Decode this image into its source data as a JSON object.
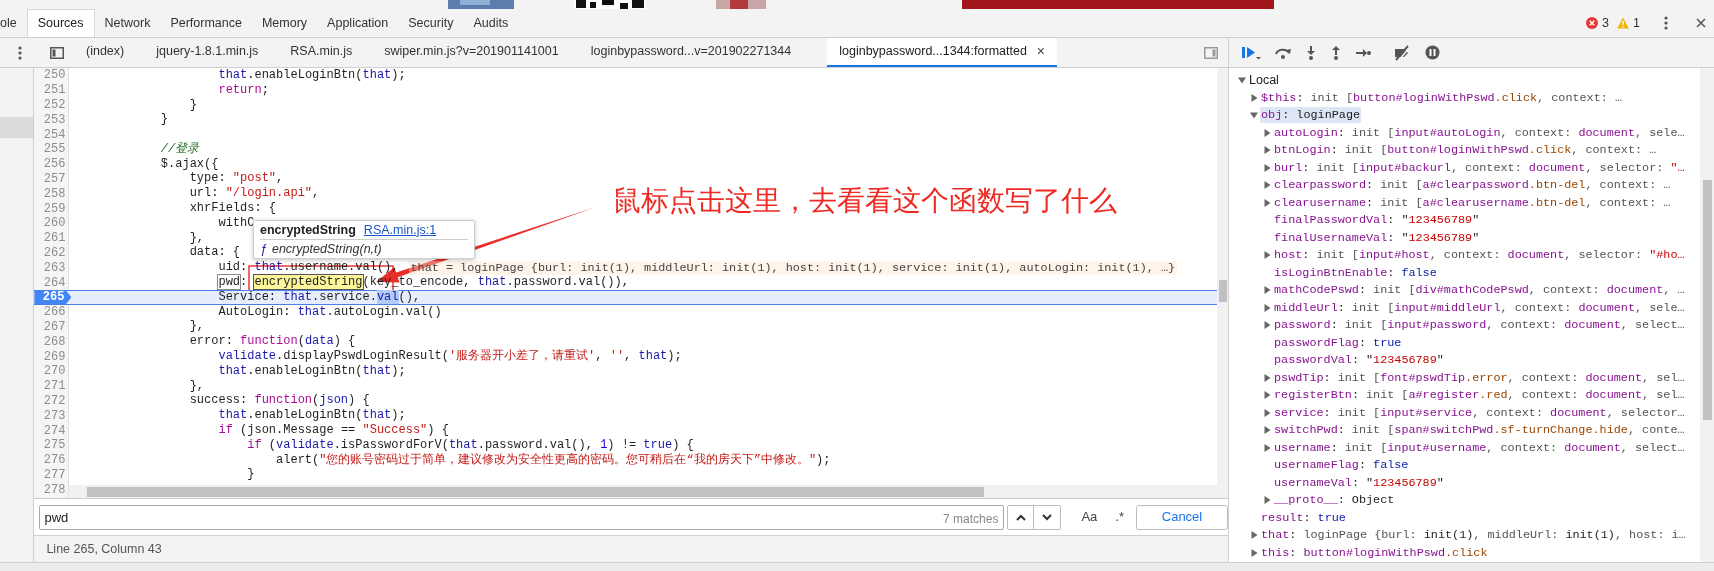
{
  "top_tabs": [
    {
      "label": "ole",
      "selected": false
    },
    {
      "label": "Sources",
      "selected": true
    },
    {
      "label": "Network",
      "selected": false
    },
    {
      "label": "Performance",
      "selected": false
    },
    {
      "label": "Memory",
      "selected": false
    },
    {
      "label": "Application",
      "selected": false
    },
    {
      "label": "Security",
      "selected": false
    },
    {
      "label": "Audits",
      "selected": false
    }
  ],
  "issue_counts": {
    "errors": "3",
    "warnings": "1"
  },
  "file_tabs": [
    {
      "label": "(index)",
      "selected": false
    },
    {
      "label": "jquery-1.8.1.min.js",
      "selected": false
    },
    {
      "label": "RSA.min.js",
      "selected": false
    },
    {
      "label": "swiper.min.js?v=201901141001",
      "selected": false
    },
    {
      "label": "loginbypassword...v=201902271344",
      "selected": false
    },
    {
      "label": "loginbypassword...1344:formatted",
      "selected": true,
      "close": "×"
    }
  ],
  "editor": {
    "lines": [
      {
        "number": "250",
        "paused": false,
        "tokens": [
          {
            "kind": "variable",
            "text": "                    that"
          },
          {
            "kind": "plain",
            "text": ".enableLoginBtn("
          },
          {
            "kind": "variable",
            "text": "that"
          },
          {
            "kind": "plain",
            "text": ");"
          }
        ]
      },
      {
        "number": "251",
        "paused": false,
        "tokens": [
          {
            "kind": "keyword",
            "text": "                    return"
          },
          {
            "kind": "plain",
            "text": ";"
          }
        ]
      },
      {
        "number": "252",
        "paused": false,
        "tokens": [
          {
            "kind": "plain",
            "text": "                }"
          }
        ]
      },
      {
        "number": "253",
        "paused": false,
        "tokens": [
          {
            "kind": "plain",
            "text": "            }"
          }
        ]
      },
      {
        "number": "254",
        "paused": false
      },
      {
        "number": "255",
        "paused": false,
        "tokens": [
          {
            "kind": "comment",
            "text": "            //登录"
          }
        ]
      },
      {
        "number": "256",
        "paused": false,
        "tokens": [
          {
            "kind": "plain",
            "text": "            $.ajax({"
          }
        ]
      },
      {
        "number": "257",
        "paused": false,
        "tokens": [
          {
            "kind": "plain",
            "text": "                type: "
          },
          {
            "kind": "string",
            "text": "\"post\""
          },
          {
            "kind": "plain",
            "text": ","
          }
        ]
      },
      {
        "number": "258",
        "paused": false,
        "tokens": [
          {
            "kind": "plain",
            "text": "                url: "
          },
          {
            "kind": "string",
            "text": "\"/login.api\""
          },
          {
            "kind": "plain",
            "text": ","
          }
        ]
      },
      {
        "number": "259",
        "paused": false,
        "tokens": [
          {
            "kind": "plain",
            "text": "                xhrFields: {"
          }
        ]
      },
      {
        "number": "260",
        "paused": false,
        "tokens": [
          {
            "kind": "plain",
            "text": "                    withC"
          }
        ]
      },
      {
        "number": "261",
        "paused": false,
        "tokens": [
          {
            "kind": "plain",
            "text": "                },"
          }
        ]
      },
      {
        "number": "262",
        "paused": false,
        "tokens": [
          {
            "kind": "plain",
            "text": "                data: {"
          }
        ]
      },
      {
        "number": "263",
        "paused": false,
        "tokens": [
          {
            "kind": "plain",
            "text": "                    uid: "
          },
          {
            "kind": "variable",
            "text": "that"
          },
          {
            "kind": "plain",
            "text": ".username.val(),"
          }
        ],
        "inline_value": "that = loginPage {burl: init(1), middleUrl: init(1), host: init(1), service: init(1), autoLogin: init(1), …}"
      },
      {
        "number": "264",
        "paused": false,
        "tokens": [
          {
            "kind": "match",
            "text": "                    pwd"
          },
          {
            "kind": "plain",
            "text": ": "
          },
          {
            "kind": "highlight",
            "text": "encryptedString"
          },
          {
            "kind": "plain",
            "text": "(key_to_encode, "
          },
          {
            "kind": "variable",
            "text": "that"
          },
          {
            "kind": "plain",
            "text": ".password.val()),"
          }
        ]
      },
      {
        "number": "265",
        "paused": true,
        "tokens": [
          {
            "kind": "plain",
            "text": "                    Service: "
          },
          {
            "kind": "variable",
            "text": "that"
          },
          {
            "kind": "plain",
            "text": ".service."
          },
          {
            "kind": "selection",
            "text": "val"
          },
          {
            "kind": "plain",
            "text": "(),"
          }
        ]
      },
      {
        "number": "266",
        "paused": false,
        "tokens": [
          {
            "kind": "plain",
            "text": "                    AutoLogin: "
          },
          {
            "kind": "variable",
            "text": "that"
          },
          {
            "kind": "plain",
            "text": ".autoLogin.val()"
          }
        ]
      },
      {
        "number": "267",
        "paused": false,
        "tokens": [
          {
            "kind": "plain",
            "text": "                },"
          }
        ]
      },
      {
        "number": "268",
        "paused": false,
        "tokens": [
          {
            "kind": "plain",
            "text": "                error: "
          },
          {
            "kind": "keyword",
            "text": "function"
          },
          {
            "kind": "plain",
            "text": "("
          },
          {
            "kind": "variable",
            "text": "data"
          },
          {
            "kind": "plain",
            "text": ") {"
          }
        ]
      },
      {
        "number": "269",
        "paused": false,
        "tokens": [
          {
            "kind": "variable",
            "text": "                    validate"
          },
          {
            "kind": "plain",
            "text": ".displayPswdLoginResult("
          },
          {
            "kind": "string",
            "text": "'服务器开小差了，请重试'"
          },
          {
            "kind": "plain",
            "text": ", "
          },
          {
            "kind": "string",
            "text": "''"
          },
          {
            "kind": "plain",
            "text": ", "
          },
          {
            "kind": "variable",
            "text": "that"
          },
          {
            "kind": "plain",
            "text": ");"
          }
        ]
      },
      {
        "number": "270",
        "paused": false,
        "tokens": [
          {
            "kind": "variable",
            "text": "                    that"
          },
          {
            "kind": "plain",
            "text": ".enableLoginBtn("
          },
          {
            "kind": "variable",
            "text": "that"
          },
          {
            "kind": "plain",
            "text": ");"
          }
        ]
      },
      {
        "number": "271",
        "paused": false,
        "tokens": [
          {
            "kind": "plain",
            "text": "                },"
          }
        ]
      },
      {
        "number": "272",
        "paused": false,
        "tokens": [
          {
            "kind": "plain",
            "text": "                success: "
          },
          {
            "kind": "keyword",
            "text": "function"
          },
          {
            "kind": "plain",
            "text": "("
          },
          {
            "kind": "variable",
            "text": "json"
          },
          {
            "kind": "plain",
            "text": ") {"
          }
        ]
      },
      {
        "number": "273",
        "paused": false,
        "tokens": [
          {
            "kind": "variable",
            "text": "                    that"
          },
          {
            "kind": "plain",
            "text": ".enableLoginBtn("
          },
          {
            "kind": "variable",
            "text": "that"
          },
          {
            "kind": "plain",
            "text": ");"
          }
        ]
      },
      {
        "number": "274",
        "paused": false,
        "tokens": [
          {
            "kind": "keyword",
            "text": "                    if"
          },
          {
            "kind": "plain",
            "text": " (json.Message == "
          },
          {
            "kind": "string",
            "text": "\"Success\""
          },
          {
            "kind": "plain",
            "text": ") {"
          }
        ]
      },
      {
        "number": "275",
        "paused": false,
        "tokens": [
          {
            "kind": "keyword",
            "text": "                        if"
          },
          {
            "kind": "plain",
            "text": " ("
          },
          {
            "kind": "variable",
            "text": "validate"
          },
          {
            "kind": "plain",
            "text": ".isPasswordForV("
          },
          {
            "kind": "variable",
            "text": "that"
          },
          {
            "kind": "plain",
            "text": ".password.val(), "
          },
          {
            "kind": "number",
            "text": "1"
          },
          {
            "kind": "plain",
            "text": ") != "
          },
          {
            "kind": "variable",
            "text": "true"
          },
          {
            "kind": "plain",
            "text": ") {"
          }
        ]
      },
      {
        "number": "276",
        "paused": false,
        "tokens": [
          {
            "kind": "plain",
            "text": "                            alert("
          },
          {
            "kind": "string",
            "text": "\"您的账号密码过于简单，建议修改为安全性更高的密码。您可稍后在“我的房天下”中修改。\""
          },
          {
            "kind": "plain",
            "text": ");"
          }
        ]
      },
      {
        "number": "277",
        "paused": false,
        "tokens": [
          {
            "kind": "plain",
            "text": "                        }"
          }
        ]
      },
      {
        "number": "278",
        "paused": false
      }
    ],
    "tooltip": {
      "title": "encryptedString",
      "link": "RSA.min.js:1",
      "glyph": "ƒ",
      "signature": "encryptedString(n,t)"
    }
  },
  "annotation": {
    "text": "鼠标点击这里，去看看这个函数写了什么"
  },
  "search": {
    "value": "pwd",
    "matches": "7 matches",
    "case_toggle": "Aa",
    "regex_toggle": ".*",
    "cancel": "Cancel"
  },
  "status_bar": {
    "text": "Line 265, Column 43"
  },
  "scope": {
    "title": "Local",
    "expanded": true,
    "items": [
      {
        "name": "$this:",
        "kind": "object",
        "expanded": false,
        "selected": false,
        "value": [
          {
            "kind": "plain",
            "text": "init ["
          },
          {
            "kind": "tag",
            "text": "button#loginWithPswd"
          },
          {
            "kind": "class",
            "text": ".click"
          },
          {
            "kind": "plain",
            "text": ", context: …"
          }
        ]
      },
      {
        "name": "obj:",
        "kind": "object",
        "expanded": true,
        "selected": true,
        "value": [
          {
            "kind": "object",
            "text": "loginPage"
          }
        ],
        "children": [
          {
            "name": "autoLogin:",
            "kind": "object",
            "expanded": false,
            "selected": false,
            "value": [
              {
                "kind": "plain",
                "text": "init ["
              },
              {
                "kind": "tag",
                "text": "input#autoLogin"
              },
              {
                "kind": "plain",
                "text": ", context: "
              },
              {
                "kind": "tag",
                "text": "document"
              },
              {
                "kind": "plain",
                "text": ", sele…"
              }
            ]
          },
          {
            "name": "btnLogin:",
            "kind": "object",
            "expanded": false,
            "selected": false,
            "value": [
              {
                "kind": "plain",
                "text": "init ["
              },
              {
                "kind": "tag",
                "text": "button#loginWithPswd"
              },
              {
                "kind": "class",
                "text": ".click"
              },
              {
                "kind": "plain",
                "text": ", context: …"
              }
            ]
          },
          {
            "name": "burl:",
            "kind": "object",
            "expanded": false,
            "selected": false,
            "value": [
              {
                "kind": "plain",
                "text": "init ["
              },
              {
                "kind": "tag",
                "text": "input#backurl"
              },
              {
                "kind": "plain",
                "text": ", context: "
              },
              {
                "kind": "tag",
                "text": "document"
              },
              {
                "kind": "plain",
                "text": ", selector: "
              },
              {
                "kind": "string",
                "text": "\"…"
              }
            ]
          },
          {
            "name": "clearpassword:",
            "kind": "object",
            "expanded": false,
            "selected": false,
            "value": [
              {
                "kind": "plain",
                "text": "init ["
              },
              {
                "kind": "tag",
                "text": "a#clearpassword"
              },
              {
                "kind": "class",
                "text": ".btn-del"
              },
              {
                "kind": "plain",
                "text": ", context: …"
              }
            ]
          },
          {
            "name": "clearusername:",
            "kind": "object",
            "expanded": false,
            "selected": false,
            "value": [
              {
                "kind": "plain",
                "text": "init ["
              },
              {
                "kind": "tag",
                "text": "a#clearusername"
              },
              {
                "kind": "class",
                "text": ".btn-del"
              },
              {
                "kind": "plain",
                "text": ", context: …"
              }
            ]
          },
          {
            "name": "finalPasswordVal:",
            "kind": "value",
            "selected": false,
            "value": [
              {
                "kind": "object",
                "text": "\""
              },
              {
                "kind": "string",
                "text": "123456789"
              },
              {
                "kind": "object",
                "text": "\""
              }
            ]
          },
          {
            "name": "finalUsernameVal:",
            "kind": "value",
            "selected": false,
            "value": [
              {
                "kind": "object",
                "text": "\""
              },
              {
                "kind": "string",
                "text": "123456789"
              },
              {
                "kind": "object",
                "text": "\""
              }
            ]
          },
          {
            "name": "host:",
            "kind": "object",
            "expanded": false,
            "selected": false,
            "value": [
              {
                "kind": "plain",
                "text": "init ["
              },
              {
                "kind": "tag",
                "text": "input#host"
              },
              {
                "kind": "plain",
                "text": ", context: "
              },
              {
                "kind": "tag",
                "text": "document"
              },
              {
                "kind": "plain",
                "text": ", selector: "
              },
              {
                "kind": "string",
                "text": "\"#ho…"
              }
            ]
          },
          {
            "name": "isLoginBtnEnable:",
            "kind": "value",
            "selected": false,
            "value": [
              {
                "kind": "boolean",
                "text": "false"
              }
            ]
          },
          {
            "name": "mathCodePswd:",
            "kind": "object",
            "expanded": false,
            "selected": false,
            "value": [
              {
                "kind": "plain",
                "text": "init ["
              },
              {
                "kind": "tag",
                "text": "div#mathCodePswd"
              },
              {
                "kind": "plain",
                "text": ", context: "
              },
              {
                "kind": "tag",
                "text": "document"
              },
              {
                "kind": "plain",
                "text": ", …"
              }
            ]
          },
          {
            "name": "middleUrl:",
            "kind": "object",
            "expanded": false,
            "selected": false,
            "value": [
              {
                "kind": "plain",
                "text": "init ["
              },
              {
                "kind": "tag",
                "text": "input#middleUrl"
              },
              {
                "kind": "plain",
                "text": ", context: "
              },
              {
                "kind": "tag",
                "text": "document"
              },
              {
                "kind": "plain",
                "text": ", sele…"
              }
            ]
          },
          {
            "name": "password:",
            "kind": "object",
            "expanded": false,
            "selected": false,
            "value": [
              {
                "kind": "plain",
                "text": "init ["
              },
              {
                "kind": "tag",
                "text": "input#password"
              },
              {
                "kind": "plain",
                "text": ", context: "
              },
              {
                "kind": "tag",
                "text": "document"
              },
              {
                "kind": "plain",
                "text": ", select…"
              }
            ]
          },
          {
            "name": "passwordFlag:",
            "kind": "value",
            "selected": false,
            "value": [
              {
                "kind": "boolean",
                "text": "true"
              }
            ]
          },
          {
            "name": "passwordVal:",
            "kind": "value",
            "selected": false,
            "value": [
              {
                "kind": "object",
                "text": "\""
              },
              {
                "kind": "string",
                "text": "123456789"
              },
              {
                "kind": "object",
                "text": "\""
              }
            ]
          },
          {
            "name": "pswdTip:",
            "kind": "object",
            "expanded": false,
            "selected": false,
            "value": [
              {
                "kind": "plain",
                "text": "init ["
              },
              {
                "kind": "tag",
                "text": "font#pswdTip"
              },
              {
                "kind": "class",
                "text": ".error"
              },
              {
                "kind": "plain",
                "text": ", context: "
              },
              {
                "kind": "tag",
                "text": "document"
              },
              {
                "kind": "plain",
                "text": ", sel…"
              }
            ]
          },
          {
            "name": "registerBtn:",
            "kind": "object",
            "expanded": false,
            "selected": false,
            "value": [
              {
                "kind": "plain",
                "text": "init ["
              },
              {
                "kind": "tag",
                "text": "a#register"
              },
              {
                "kind": "class",
                "text": ".red"
              },
              {
                "kind": "plain",
                "text": ", context: "
              },
              {
                "kind": "tag",
                "text": "document"
              },
              {
                "kind": "plain",
                "text": ", sel…"
              }
            ]
          },
          {
            "name": "service:",
            "kind": "object",
            "expanded": false,
            "selected": false,
            "value": [
              {
                "kind": "plain",
                "text": "init ["
              },
              {
                "kind": "tag",
                "text": "input#service"
              },
              {
                "kind": "plain",
                "text": ", context: "
              },
              {
                "kind": "tag",
                "text": "document"
              },
              {
                "kind": "plain",
                "text": ", selector…"
              }
            ]
          },
          {
            "name": "switchPwd:",
            "kind": "object",
            "expanded": false,
            "selected": false,
            "value": [
              {
                "kind": "plain",
                "text": "init ["
              },
              {
                "kind": "tag",
                "text": "span#switchPwd"
              },
              {
                "kind": "class",
                "text": ".sf-turnChange.hide"
              },
              {
                "kind": "plain",
                "text": ", conte…"
              }
            ]
          },
          {
            "name": "username:",
            "kind": "object",
            "expanded": false,
            "selected": false,
            "value": [
              {
                "kind": "plain",
                "text": "init ["
              },
              {
                "kind": "tag",
                "text": "input#username"
              },
              {
                "kind": "plain",
                "text": ", context: "
              },
              {
                "kind": "tag",
                "text": "document"
              },
              {
                "kind": "plain",
                "text": ", select…"
              }
            ]
          },
          {
            "name": "usernameFlag:",
            "kind": "value",
            "selected": false,
            "value": [
              {
                "kind": "boolean",
                "text": "false"
              }
            ]
          },
          {
            "name": "usernameVal:",
            "kind": "value",
            "selected": false,
            "value": [
              {
                "kind": "object",
                "text": "\""
              },
              {
                "kind": "string",
                "text": "123456789"
              },
              {
                "kind": "object",
                "text": "\""
              }
            ]
          },
          {
            "name": "__proto__:",
            "kind": "object",
            "expanded": false,
            "selected": false,
            "value": [
              {
                "kind": "object",
                "text": "Object"
              }
            ]
          }
        ]
      },
      {
        "name": "result:",
        "kind": "value",
        "selected": false,
        "value": [
          {
            "kind": "boolean",
            "text": "true"
          }
        ]
      },
      {
        "name": "that:",
        "kind": "object",
        "expanded": false,
        "selected": false,
        "value": [
          {
            "kind": "plain",
            "text": "loginPage {burl: "
          },
          {
            "kind": "object",
            "text": "init(1)"
          },
          {
            "kind": "plain",
            "text": ", middleUrl: "
          },
          {
            "kind": "object",
            "text": "init(1)"
          },
          {
            "kind": "plain",
            "text": ", host: i…"
          }
        ]
      },
      {
        "name": "this:",
        "kind": "object",
        "expanded": false,
        "selected": false,
        "value": [
          {
            "kind": "tag",
            "text": "button#loginWithPswd"
          },
          {
            "kind": "class",
            "text": ".click"
          }
        ]
      }
    ]
  }
}
